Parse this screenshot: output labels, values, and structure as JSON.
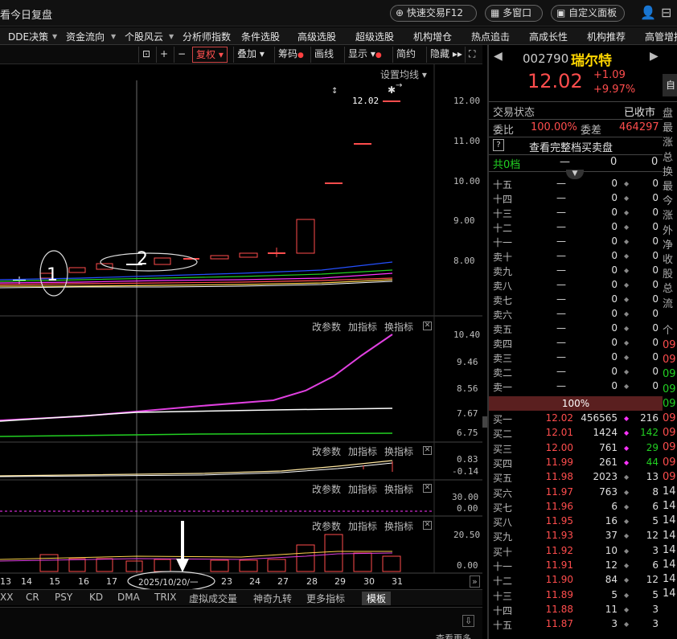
{
  "window": {
    "title": "看今日复盘",
    "quick_trade": "快速交易F12",
    "multi_window": "多窗口",
    "custom_panel": "自定义面板"
  },
  "menu": [
    "DDE决策",
    "资金流向",
    "个股风云",
    "分析师指数",
    "条件选股",
    "高级选股",
    "超级选股",
    "机构增仓",
    "热点追击",
    "高成长性",
    "机构推荐",
    "高管增持"
  ],
  "toolbar": {
    "fuquan": "复权",
    "diejia": "叠加",
    "chouma": "筹码",
    "huaxian": "画线",
    "xianshi": "显示",
    "jianyue": "简约",
    "yincang": "隐藏"
  },
  "main_chart": {
    "settings_label": "设置均线",
    "last_price_tag": "12.02",
    "y_labels": [
      "12.00",
      "11.00",
      "10.00",
      "9.00",
      "8.00"
    ],
    "annotation_1": "1",
    "annotation_2": "2"
  },
  "panel_header": {
    "change_params": "改参数",
    "add_indicator": "加指标",
    "switch_indicator": "换指标"
  },
  "panel1": {
    "y_labels": [
      "10.40",
      "9.46",
      "8.56",
      "7.67",
      "6.75"
    ]
  },
  "panel2": {
    "y_labels": [
      "0.83",
      "-0.14"
    ]
  },
  "panel3": {
    "y_labels": [
      "30.00",
      "0.00"
    ]
  },
  "panel4": {
    "y_labels": [
      "20.50",
      "0.00"
    ]
  },
  "x_axis": {
    "labels": [
      "13",
      "14",
      "15",
      "16",
      "17",
      "2025/10/20/一",
      "23",
      "24",
      "27",
      "28",
      "29",
      "30",
      "31"
    ]
  },
  "bottom_tabs": [
    "XX",
    "CR",
    "PSY",
    "KD",
    "DMA",
    "TRIX",
    "虚拟成交量",
    "神奇九转",
    "更多指标",
    "模板"
  ],
  "bottom_right": "查看更多",
  "stock": {
    "code": "002790",
    "name": "瑞尔特",
    "price": "12.02",
    "change": "+1.09",
    "change_pct": "+9.97%",
    "side_button": "自"
  },
  "status": {
    "label": "交易状态",
    "value": "已收市",
    "weibi_label": "委比",
    "weibi_value": "100.00%",
    "weicha_label": "委差",
    "weicha_value": "464297",
    "full_depth": "查看完整档买卖盘",
    "total_levels": "共0档",
    "dash": "—",
    "zero": "0",
    "pct_bar": "100%"
  },
  "sell_levels": [
    "十五",
    "十四",
    "十三",
    "十二",
    "十一",
    "卖十",
    "卖九",
    "卖八",
    "卖七",
    "卖六",
    "卖五",
    "卖四",
    "卖三",
    "卖二",
    "卖一"
  ],
  "buy_levels": [
    {
      "label": "买一",
      "price": "12.02",
      "vol": "456565",
      "mark": "◆",
      "chg": "216"
    },
    {
      "label": "买二",
      "price": "12.01",
      "vol": "1424",
      "mark": "◆",
      "chg": "142"
    },
    {
      "label": "买三",
      "price": "12.00",
      "vol": "761",
      "mark": "◆",
      "chg": "29"
    },
    {
      "label": "买四",
      "price": "11.99",
      "vol": "261",
      "mark": "◆",
      "chg": "44"
    },
    {
      "label": "买五",
      "price": "11.98",
      "vol": "2023",
      "mark": "◆",
      "chg": "13"
    },
    {
      "label": "买六",
      "price": "11.97",
      "vol": "763",
      "mark": "◆",
      "chg": "8"
    },
    {
      "label": "买七",
      "price": "11.96",
      "vol": "6",
      "mark": "◆",
      "chg": "6"
    },
    {
      "label": "买八",
      "price": "11.95",
      "vol": "16",
      "mark": "◆",
      "chg": "5"
    },
    {
      "label": "买九",
      "price": "11.93",
      "vol": "37",
      "mark": "◆",
      "chg": "12"
    },
    {
      "label": "买十",
      "price": "11.92",
      "vol": "10",
      "mark": "◆",
      "chg": "3"
    },
    {
      "label": "十一",
      "price": "11.91",
      "vol": "12",
      "mark": "◆",
      "chg": "6"
    },
    {
      "label": "十二",
      "price": "11.90",
      "vol": "84",
      "mark": "◆",
      "chg": "12"
    },
    {
      "label": "十三",
      "price": "11.89",
      "vol": "5",
      "mark": "◆",
      "chg": "5"
    },
    {
      "label": "十四",
      "price": "11.88",
      "vol": "11",
      "mark": "◆",
      "chg": "3"
    },
    {
      "label": "十五",
      "price": "11.87",
      "vol": "3",
      "mark": "◆",
      "chg": "3"
    }
  ],
  "edge_col": [
    "盘",
    "最",
    "涨",
    "总",
    "换",
    "最",
    "今",
    "涨",
    "外",
    "净",
    "收",
    "股",
    "总",
    "流",
    "个",
    "09",
    "09",
    "09",
    "09",
    "09",
    "09",
    "09",
    "09",
    "09",
    "09",
    "14",
    "14",
    "14",
    "14",
    "14",
    "14",
    "14",
    "14"
  ],
  "colors": {
    "up": "#ff4d4d",
    "down": "#22d022",
    "accent": "#ff33ff"
  }
}
